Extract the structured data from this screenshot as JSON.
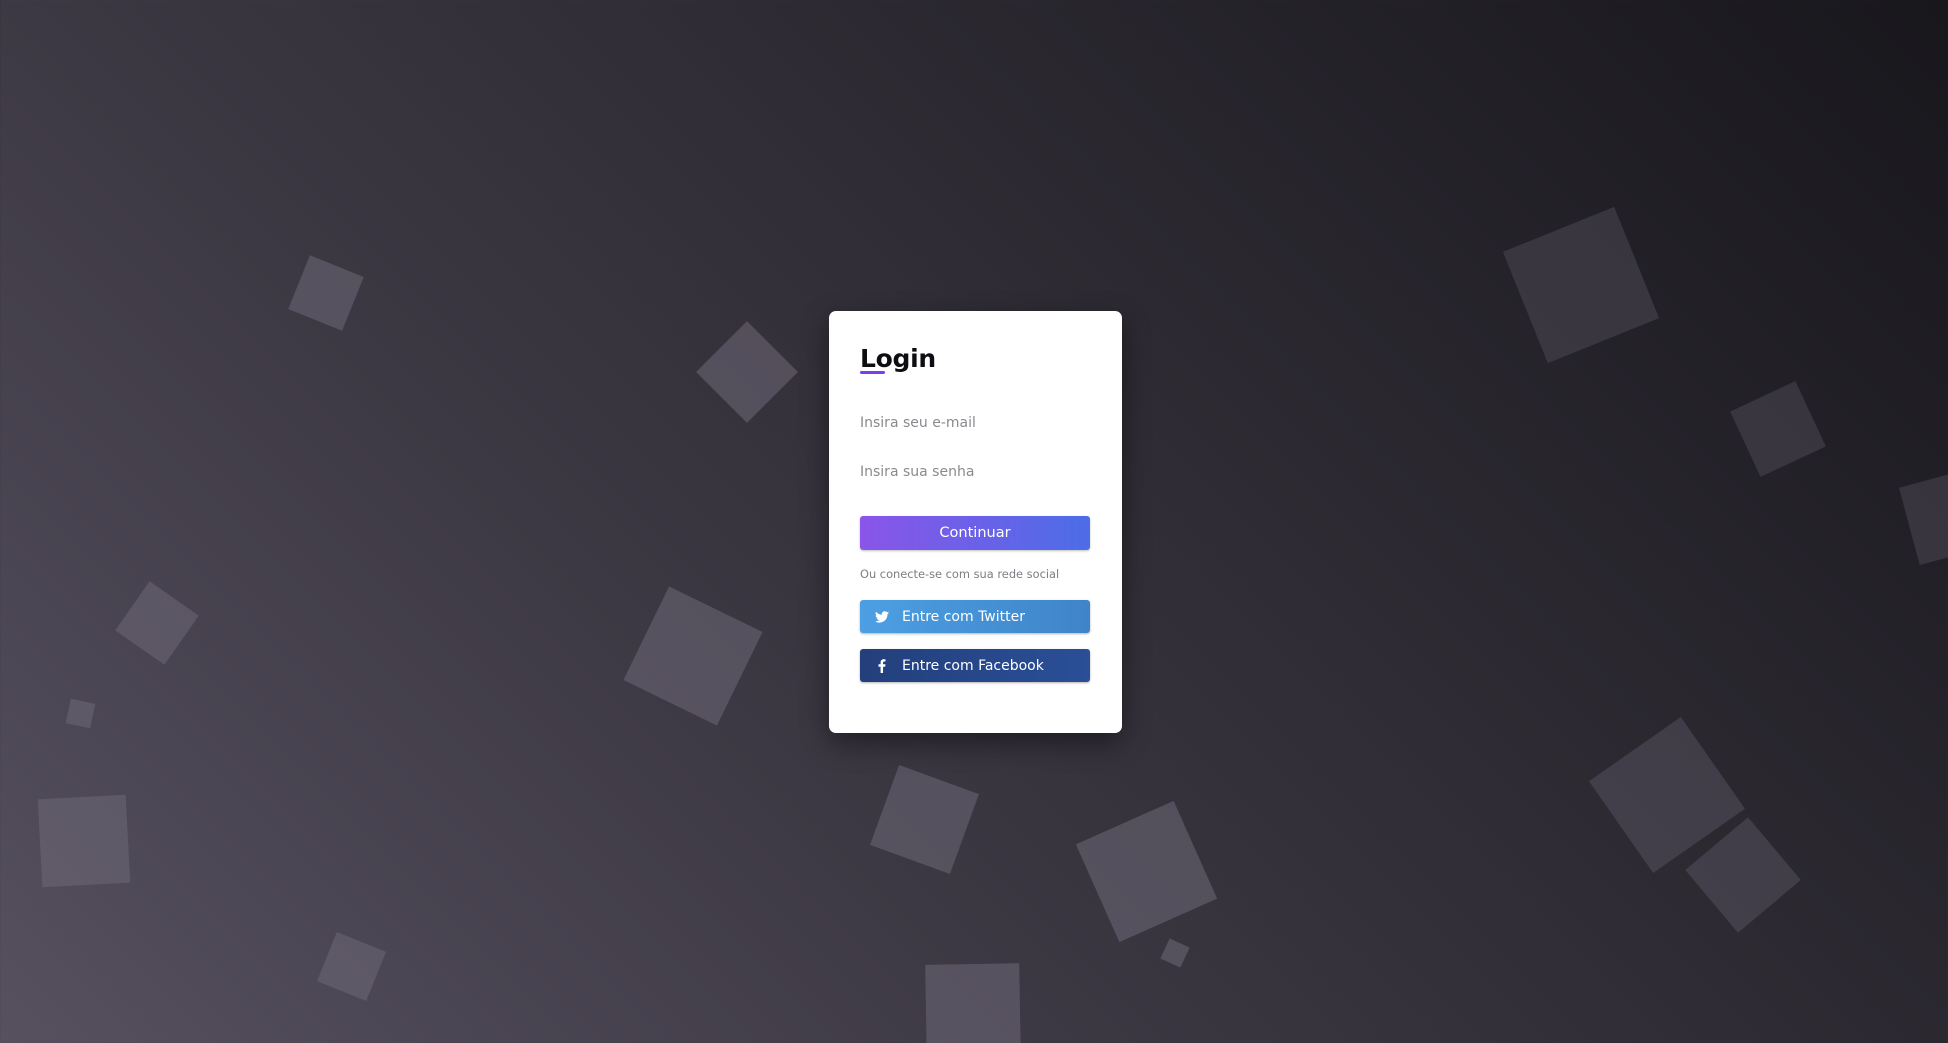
{
  "login": {
    "title": "Login",
    "email_placeholder": "Insira seu e-mail",
    "password_placeholder": "Insira sua senha",
    "continue_label": "Continuar",
    "social_prompt": "Ou conecte-se com sua rede social",
    "twitter_label": "Entre com Twitter",
    "facebook_label": "Entre com Facebook"
  },
  "icons": {
    "twitter": "twitter-bird-icon",
    "facebook": "facebook-f-icon"
  },
  "colors": {
    "accent_start": "#8a55e9",
    "accent_end": "#4c6de6",
    "twitter": "#4d9fe3",
    "facebook": "#233f7c",
    "title_underline": "#7a3df0"
  }
}
